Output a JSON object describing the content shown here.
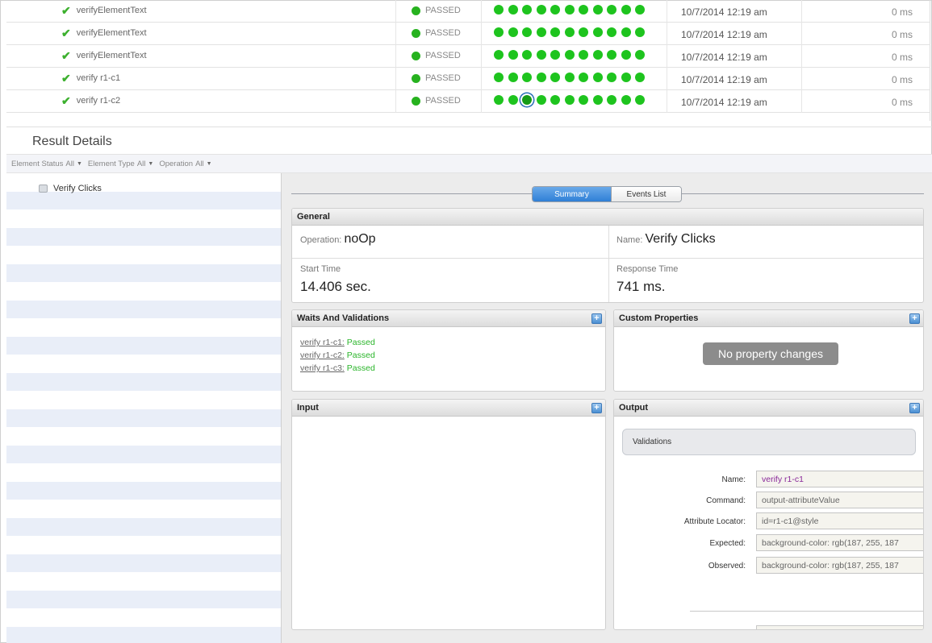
{
  "results": {
    "rows": [
      {
        "name": "verifyElementText",
        "status": "PASSED",
        "date": "10/7/2014 12:19 am",
        "duration": "0 ms"
      },
      {
        "name": "verifyElementText",
        "status": "PASSED",
        "date": "10/7/2014 12:19 am",
        "duration": "0 ms"
      },
      {
        "name": "verifyElementText",
        "status": "PASSED",
        "date": "10/7/2014 12:19 am",
        "duration": "0 ms"
      },
      {
        "name": "verify r1-c1",
        "status": "PASSED",
        "date": "10/7/2014 12:19 am",
        "duration": "0 ms"
      },
      {
        "name": "verify r1-c2",
        "status": "PASSED",
        "date": "10/7/2014 12:19 am",
        "duration": "0 ms"
      }
    ],
    "status_color": "#27b21f",
    "dot_color": "#1ec41e",
    "selected_dot_row": 4,
    "selected_dot_index": 2
  },
  "result_details": {
    "title": "Result Details",
    "filters": [
      {
        "label": "Element Status",
        "value": "All"
      },
      {
        "label": "Element Type",
        "value": "All"
      },
      {
        "label": "Operation",
        "value": "All"
      }
    ],
    "tree": {
      "root_label": "Verify Clicks"
    }
  },
  "tabs": {
    "summary": "Summary",
    "events": "Events List",
    "active": "Summary"
  },
  "general": {
    "header": "General",
    "operation_label": "Operation:",
    "operation_value": "noOp",
    "name_label": "Name:",
    "name_value": "Verify Clicks",
    "start_label": "Start Time",
    "start_value": "14.406 sec.",
    "response_label": "Response Time",
    "response_value": "741 ms."
  },
  "waits": {
    "header": "Waits And Validations",
    "items": [
      {
        "link": "verify r1-c1:",
        "result": "Passed"
      },
      {
        "link": "verify r1-c2:",
        "result": "Passed"
      },
      {
        "link": "verify r1-c3:",
        "result": "Passed"
      }
    ]
  },
  "custom": {
    "header": "Custom Properties",
    "empty": "No property changes"
  },
  "input": {
    "header": "Input"
  },
  "output": {
    "header": "Output",
    "validations_title": "Validations",
    "fields": [
      {
        "label": "Name:",
        "value": "verify r1-c1"
      },
      {
        "label": "Command:",
        "value": "output-attributeValue"
      },
      {
        "label": "Attribute Locator:",
        "value": "id=r1-c1@style"
      },
      {
        "label": "Expected:",
        "value": "background-color: rgb(187, 255, 187"
      },
      {
        "label": "Observed:",
        "value": "background-color: rgb(187, 255, 187"
      }
    ]
  }
}
